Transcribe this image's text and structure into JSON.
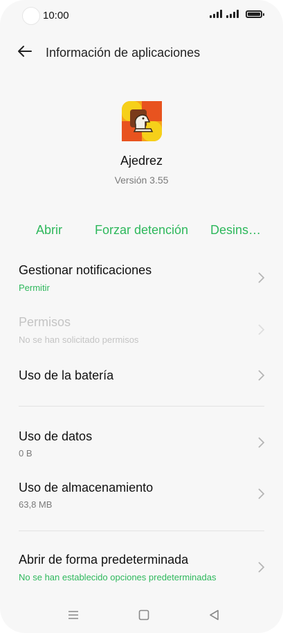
{
  "status_bar": {
    "time": "10:00"
  },
  "header": {
    "title": "Información de aplicaciones",
    "back_icon": "arrow-left-icon"
  },
  "app": {
    "name": "Ajedrez",
    "version": "Versión 3.55",
    "icon": "chess-knight-icon"
  },
  "actions": {
    "open": "Abrir",
    "force_stop": "Forzar detención",
    "uninstall": "Desins…"
  },
  "items": [
    {
      "title": "Gestionar notificaciones",
      "subtitle": "Permitir"
    },
    {
      "title": "Permisos",
      "subtitle": "No se han solicitado permisos"
    },
    {
      "title": "Uso de la batería",
      "subtitle": ""
    },
    {
      "title": "Uso de datos",
      "subtitle": "0 B"
    },
    {
      "title": "Uso de almacenamiento",
      "subtitle": "63,8 MB"
    },
    {
      "title": "Abrir de forma predeterminada",
      "subtitle": "No se han establecido opciones predeterminadas"
    }
  ],
  "colors": {
    "accent": "#2eb85c",
    "text": "#111111",
    "secondary": "#7a7a7a",
    "disabled": "#c4c4c4"
  }
}
